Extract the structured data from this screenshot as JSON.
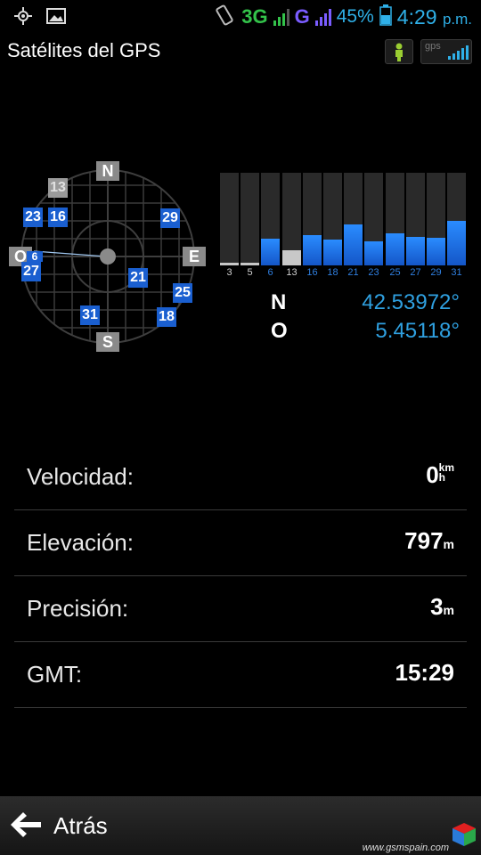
{
  "status_bar": {
    "network": "3G",
    "network2": "G",
    "sim1": "1",
    "sim2": "2",
    "battery": "45%",
    "time": "4:29",
    "ampm": "p.m."
  },
  "header": {
    "title": "Satélites del GPS",
    "gps_icon_label": "gps"
  },
  "radar": {
    "compass": {
      "n": "N",
      "s": "S",
      "e": "E",
      "w": "O"
    },
    "satellites": [
      {
        "id": "13",
        "active": false
      },
      {
        "id": "23",
        "active": true
      },
      {
        "id": "16",
        "active": true
      },
      {
        "id": "29",
        "active": true
      },
      {
        "id": "6",
        "active": true
      },
      {
        "id": "27",
        "active": true
      },
      {
        "id": "21",
        "active": true
      },
      {
        "id": "25",
        "active": true
      },
      {
        "id": "31",
        "active": true
      },
      {
        "id": "18",
        "active": true
      }
    ]
  },
  "signal_chart": {
    "bars": [
      {
        "id": "3",
        "strength": 0.03,
        "active": false
      },
      {
        "id": "5",
        "strength": 0.03,
        "active": false
      },
      {
        "id": "6",
        "strength": 0.29,
        "active": true
      },
      {
        "id": "13",
        "strength": 0.16,
        "active": false
      },
      {
        "id": "16",
        "strength": 0.33,
        "active": true
      },
      {
        "id": "18",
        "strength": 0.28,
        "active": true
      },
      {
        "id": "21",
        "strength": 0.44,
        "active": true
      },
      {
        "id": "23",
        "strength": 0.26,
        "active": true
      },
      {
        "id": "25",
        "strength": 0.35,
        "active": true
      },
      {
        "id": "27",
        "strength": 0.31,
        "active": true
      },
      {
        "id": "29",
        "strength": 0.3,
        "active": true
      },
      {
        "id": "31",
        "strength": 0.48,
        "active": true
      }
    ]
  },
  "coordinates": {
    "lat_dir": "N",
    "lat_value": "42.53972°",
    "lon_dir": "O",
    "lon_value": "5.45118°"
  },
  "info": {
    "speed": {
      "label": "Velocidad:",
      "value": "0",
      "unit_top": "km",
      "unit_bottom": "h"
    },
    "elevation": {
      "label": "Elevación:",
      "value": "797",
      "unit": "m"
    },
    "precision": {
      "label": "Precisión:",
      "value": "3",
      "unit": "m"
    },
    "gmt": {
      "label": "GMT:",
      "value": "15:29"
    }
  },
  "bottom": {
    "back_label": "Atrás",
    "watermark": "www.gsmspain.com"
  },
  "colors": {
    "accent_blue": "#2fb0e8",
    "sat_blue": "#1a5fd0",
    "bar_blue": "#1e78e8",
    "inactive_gray": "#9a9a9a"
  }
}
